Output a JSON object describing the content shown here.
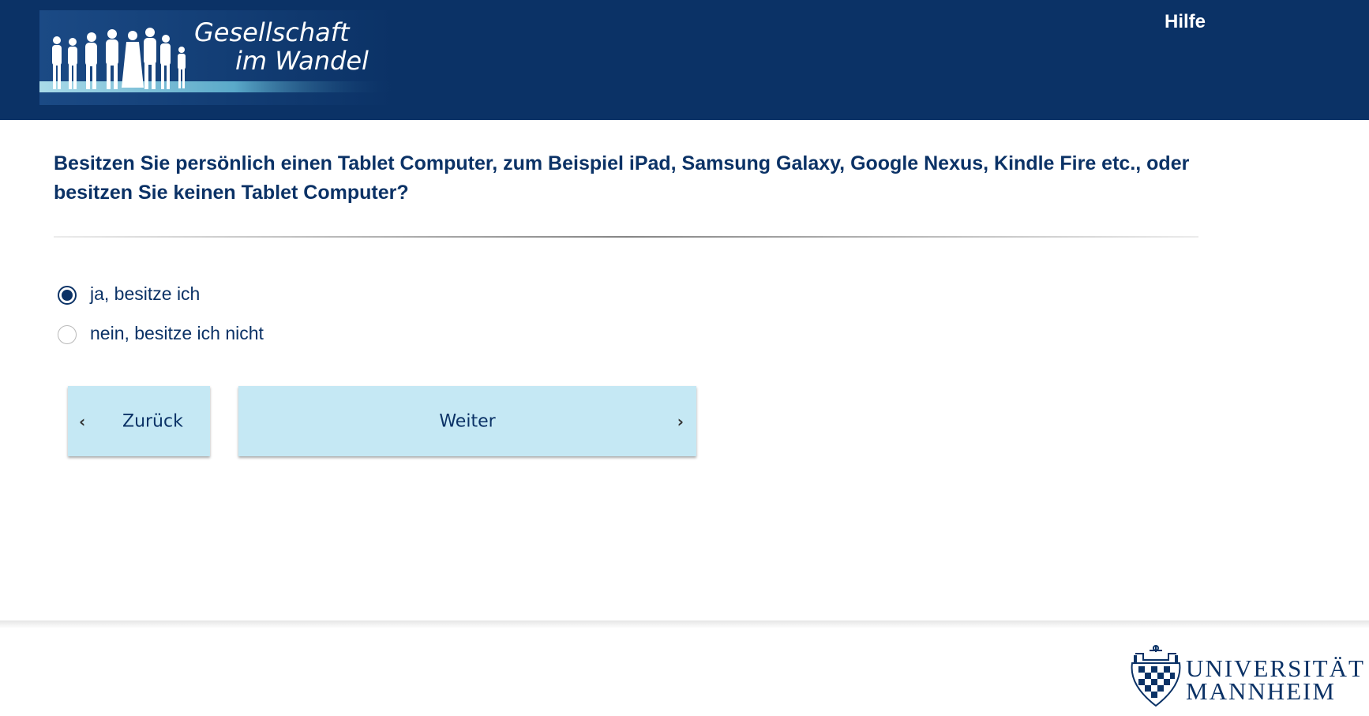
{
  "header": {
    "logo": {
      "line1": "Gesellschaft",
      "line2": "im Wandel"
    },
    "help_link": "Hilfe"
  },
  "question": {
    "text": "Besitzen Sie persönlich einen Tablet Computer, zum Beispiel iPad, Samsung Galaxy, Google Nexus, Kindle Fire etc., oder besitzen Sie keinen Tablet Computer?"
  },
  "options": [
    {
      "label": "ja, besitze ich",
      "selected": true
    },
    {
      "label": "nein, besitze ich nicht",
      "selected": false
    }
  ],
  "nav": {
    "back_label": "Zurück",
    "next_label": "Weiter"
  },
  "footer": {
    "university_line1": "UNIVERSITÄT",
    "university_line2": "MANNHEIM"
  },
  "colors": {
    "header_bg": "#0b3266",
    "text": "#0b3266",
    "button_bg": "#c5e8f4"
  },
  "icons": {
    "back": "chevron-left-icon",
    "next": "chevron-right-icon",
    "crest": "university-crest-icon"
  }
}
